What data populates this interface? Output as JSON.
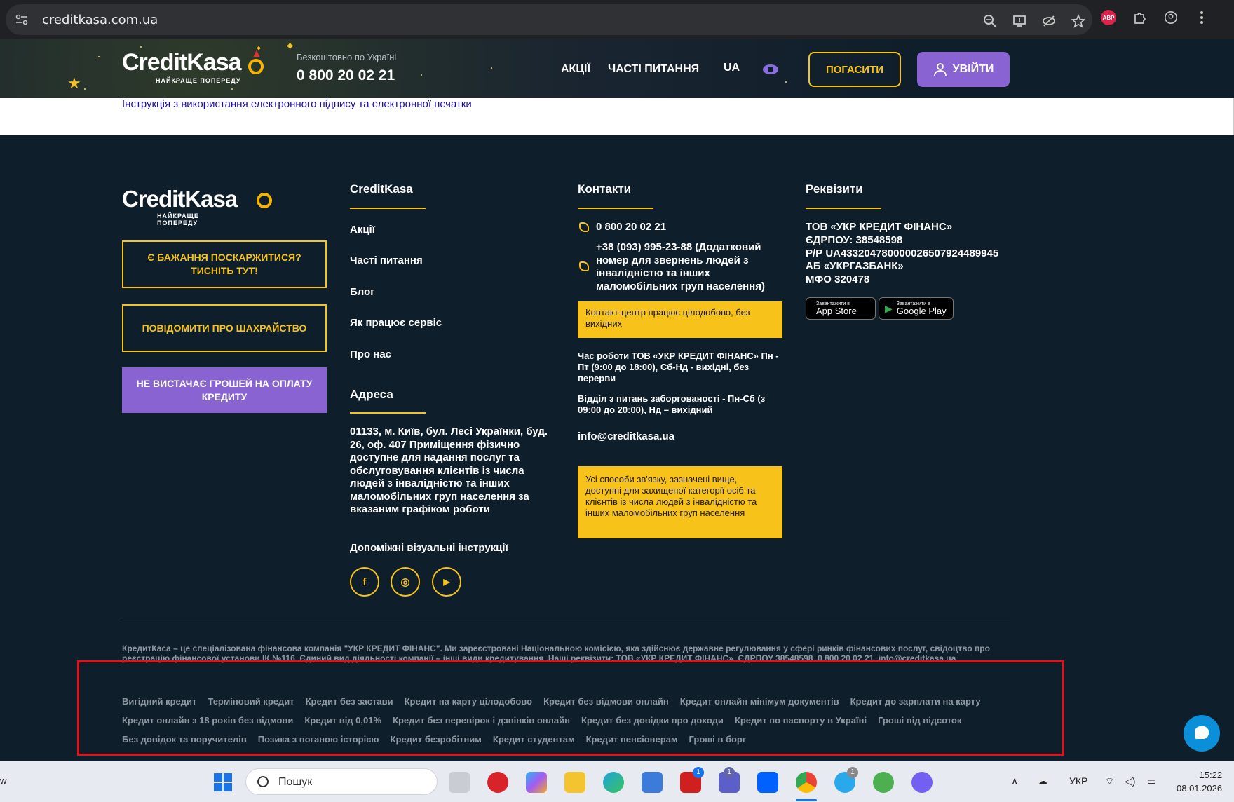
{
  "browser": {
    "url": "creditkasa.com.ua",
    "extension_badge": "ABP"
  },
  "header": {
    "logo_word_1": "Credit",
    "logo_word_2": "Kasa",
    "logo_tagline": "НАЙКРАЩЕ ПОПЕРЕДУ",
    "free_label": "Безкоштовно по Україні",
    "phone": "0 800 20 02 21",
    "nav": [
      "АКЦІЇ",
      "ЧАСТІ ПИТАННЯ",
      "UA"
    ],
    "pay_button": "ПОГАСИТИ",
    "login_button": "УВІЙТИ"
  },
  "white_strip": {
    "link": "Інструкція з використання електронного підпису та електронної печатки"
  },
  "footer": {
    "logo_word_1": "Credit",
    "logo_word_2": "Kasa",
    "logo_tagline": "НАЙКРАЩЕ ПОПЕРЕДУ",
    "complaint_button": "Є БАЖАННЯ ПОСКАРЖИТИСЯ? ТИСНІТЬ ТУТ!",
    "fraud_button": "ПОВІДОМИТИ ПРО ШАХРАЙСТВО",
    "no_money_button": "НЕ ВИСТАЧАЄ ГРОШЕЙ НА ОПЛАТУ КРЕДИТУ",
    "menu_title": "CreditKasa",
    "menu": [
      "Акції",
      "Часті питання",
      "Блог",
      "Як працює сервіс",
      "Про нас"
    ],
    "address_title": "Адреса",
    "address": "01133, м. Київ, бул. Лесі Українки, буд. 26, оф. 407 Приміщення фізично доступне для надання послуг та обслуговування клієнтів із числа людей з інвалідністю та інших маломобільних груп населення за вказаним графіком роботи",
    "visual_instructions": "Допоміжні візуальні інструкції",
    "social": [
      "f",
      "◎",
      "▶"
    ],
    "contacts_title": "Контакти",
    "phone_1": "0 800 20 02 21",
    "phone_2": "+38 (093) 995-23-88 (Додатковий номер для звернень людей з інвалідністю та інших маломобільних груп населення)",
    "contact_center": "Контакт-центр працює цілодобово, без вихідних",
    "work_hours": "Час роботи ТОВ «УКР КРЕДИТ ФІНАНС» Пн - Пт (9:00 до 18:00), Сб-Нд - вихідні, без перерви",
    "debt_hours": "Відділ з питань заборгованості - Пн-Сб (з 09:00 до 20:00), Нд – вихідний",
    "email": "info@creditkasa.ua",
    "accessibility_note": "Усі способи зв'язку, зазначені вище, доступні для захищеної категорії осіб та клієнтів із числа людей з інвалідністю та інших маломобільних груп населення",
    "requisites_title": "Реквізити",
    "requisites": [
      "ТОВ «УКР КРЕДИТ ФІНАНС»",
      "ЄДРПОУ: 38548598",
      "Р/Р UA433204780000026507924489945",
      "АБ «УКРГАЗБАНК»",
      "МФО 320478"
    ],
    "app_store_small": "Завантажити в",
    "app_store": "App Store",
    "google_play_small": "Завантажити в",
    "google_play": "Google Play",
    "about": "КредитКаса – це спеціалізована фінансова компанія \"УКР КРЕДИТ ФІНАНС\". Ми зареєстровані Національною комісією, яка здійснює державне регулювання у сфері ринків фінансових послуг, свідоцтво про реєстрацію фінансової установи ІК №116. Єдиний вид діяльності компанії – інші види кредитування. Наші реквізити: ТОВ «УКР КРЕДИТ ФІНАНС», ЄДРПОУ 38548598, 0 800 20 02 21, info@creditkasa.ua.",
    "seo_rows": [
      [
        "Вигідний кредит",
        "Терміновий кредит",
        "Кредит без застави",
        "Кредит на карту цілодобово",
        "Кредит без відмови онлайн",
        "Кредит онлайн мінімум документів",
        "Кредит до зарплати на карту"
      ],
      [
        "Кредит онлайн з 18 років без відмови",
        "Кредит від 0,01%",
        "Кредит без перевірок і дзвінків онлайн",
        "Кредит без довідки про доходи",
        "Кредит по паспорту в Україні",
        "Гроші під відсоток"
      ],
      [
        "Без довідок та поручителів",
        "Позика з поганою історією",
        "Кредит безробітним",
        "Кредит студентам",
        "Кредит пенсіонерам",
        "Гроші в борг"
      ]
    ]
  },
  "taskbar": {
    "left_text": "w",
    "search": "Пошук",
    "badge_l": "1",
    "badge_teams": "1",
    "badge_telegram": "1",
    "language": "УКР",
    "time": "15:22",
    "date": "08.01.2026"
  },
  "colors": {
    "accent_yellow": "#f7c21a",
    "accent_purple": "#8a63d2",
    "footer_bg": "#0f1e2b",
    "highlight_box": "#e0121b"
  }
}
